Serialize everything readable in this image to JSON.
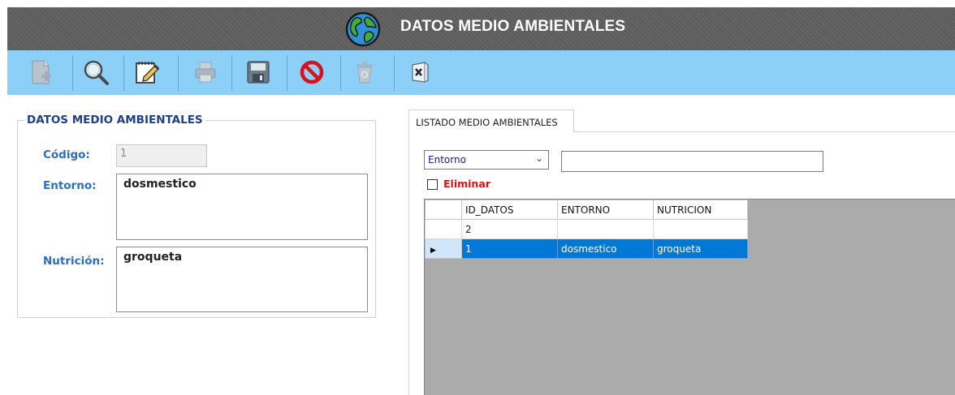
{
  "window": {
    "title": "DATOS MEDIO AMBIENTALES",
    "icon": "globe-icon"
  },
  "toolbar": {
    "buttons": [
      {
        "name": "new",
        "icon": "new-document-icon",
        "enabled": false
      },
      {
        "name": "search",
        "icon": "magnifier-icon",
        "enabled": true
      },
      {
        "name": "edit",
        "icon": "edit-pencil-icon",
        "enabled": true
      },
      {
        "name": "print",
        "icon": "printer-icon",
        "enabled": false
      },
      {
        "name": "save",
        "icon": "floppy-disk-icon",
        "enabled": true
      },
      {
        "name": "cancel",
        "icon": "prohibited-icon",
        "enabled": true
      },
      {
        "name": "delete",
        "icon": "trash-icon",
        "enabled": false
      },
      {
        "name": "exit",
        "icon": "exit-door-icon",
        "enabled": true
      }
    ]
  },
  "form": {
    "legend": "DATOS MEDIO AMBIENTALES",
    "codigo_label": "Código:",
    "codigo_value": "1",
    "entorno_label": "Entorno:",
    "entorno_value": "dosmestico",
    "nutricion_label": "Nutrición:",
    "nutricion_value": "groqueta"
  },
  "listado": {
    "tab_label": "LISTADO MEDIO AMBIENTALES",
    "filter_field": "Entorno",
    "search_value": "",
    "eliminar_label": "Eliminar",
    "eliminar_checked": false,
    "columns": [
      "ID_DATOS",
      "ENTORNO",
      "NUTRICION"
    ],
    "rows": [
      {
        "id": "2",
        "entorno": "",
        "nutricion": "",
        "selected": false
      },
      {
        "id": "1",
        "entorno": "dosmestico",
        "nutricion": "groqueta",
        "selected": true
      }
    ]
  },
  "colors": {
    "titlebar": "#5f5f5f",
    "toolbar": "#8ccff7",
    "label_blue": "#2c6fbd",
    "legend_blue": "#1f3f86",
    "selection": "#0078d7",
    "danger_red": "#e01010",
    "grid_bg": "#ababab"
  }
}
